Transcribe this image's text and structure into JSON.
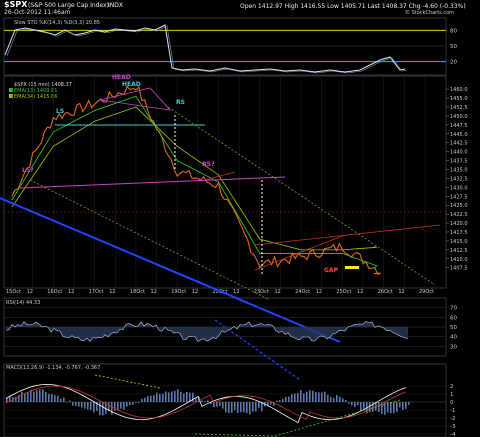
{
  "header": {
    "symbol": "$SPX",
    "name": "(S&P 500 Large Cap Index)",
    "exchange": "INDX",
    "date": "26-Oct-2012 11:46am",
    "ohlc": "Open 1412.97  High 1416.55  Low 1405.71  Last 1408.37  Chg -4.60 (-0.33%)",
    "brand": "© StockCharts.com"
  },
  "stoch_panel": {
    "legend": "Slow STO %K(14,3) %D(3,3) 20.85",
    "levels": [
      80,
      50,
      20
    ]
  },
  "price_panel": {
    "legend_symbol": "$SPX (15 min) 1408.37",
    "legend_ema13": "EMA(13) 1409.81",
    "legend_ema34": "EMA(34) 1415.86",
    "y_ticks": [
      1460,
      1455,
      1450,
      1447.5,
      1445,
      1442.5,
      1440,
      1437.5,
      1435,
      1432.5,
      1430,
      1427.5,
      1425,
      1422.5,
      1420,
      1417.5,
      1415,
      1412.5,
      1410,
      1407.5
    ],
    "y_tick_labels": [
      "1460.0",
      "1455.0",
      "1452.5",
      "1450.0",
      "1447.5",
      "1445.0",
      "1442.5",
      "1440.0",
      "1437.5",
      "1435.0",
      "1432.5",
      "1430.0",
      "1427.5",
      "1425.0",
      "1422.5",
      "1420.0",
      "1417.5",
      "1415.0",
      "1412.5",
      "1410.0",
      "1407.5"
    ],
    "x_tick_labels": [
      "15Oct",
      "12",
      "16Oct",
      "12",
      "17Oct",
      "12",
      "18Oct",
      "12",
      "19Oct",
      "12",
      "22Oct",
      "12",
      "23Oct",
      "12",
      "24Oct",
      "12",
      "25Oct",
      "12",
      "26Oct",
      "12",
      "29Oct"
    ],
    "annotations": [
      "LS?",
      "LS",
      "HEAD",
      "HEAD",
      "RS",
      "RS?",
      "GAP"
    ]
  },
  "rsi_panel": {
    "legend": "RSI(14) 44.33",
    "levels": [
      70,
      60,
      50,
      40,
      30
    ]
  },
  "macd_panel": {
    "legend": "MACD(12,26,9) -1.134, -0.767, -0.367",
    "levels": [
      2,
      1,
      0,
      -1,
      -2,
      -3,
      -4
    ]
  },
  "chart_data": {
    "type": "line",
    "title": "$SPX (S&P 500 Large Cap Index) INDX",
    "xlabel": "",
    "ylabel": "",
    "ylim": [
      1405,
      1463
    ],
    "x": [
      "15Oct",
      "16Oct",
      "17Oct",
      "18Oct",
      "19Oct",
      "22Oct",
      "23Oct",
      "24Oct",
      "25Oct",
      "26Oct"
    ],
    "series": [
      {
        "name": "$SPX (15 min)",
        "values": [
          1430,
          1452,
          1456,
          1461,
          1437,
          1433,
          1411,
          1413,
          1416,
          1408.37
        ]
      },
      {
        "name": "EMA(13)",
        "values": [
          1429,
          1448,
          1454,
          1458,
          1440,
          1434,
          1414,
          1414,
          1414,
          1409.81
        ]
      },
      {
        "name": "EMA(34)",
        "values": [
          1427,
          1444,
          1451,
          1455,
          1444,
          1436,
          1418,
          1415,
          1415,
          1415.86
        ]
      }
    ]
  }
}
